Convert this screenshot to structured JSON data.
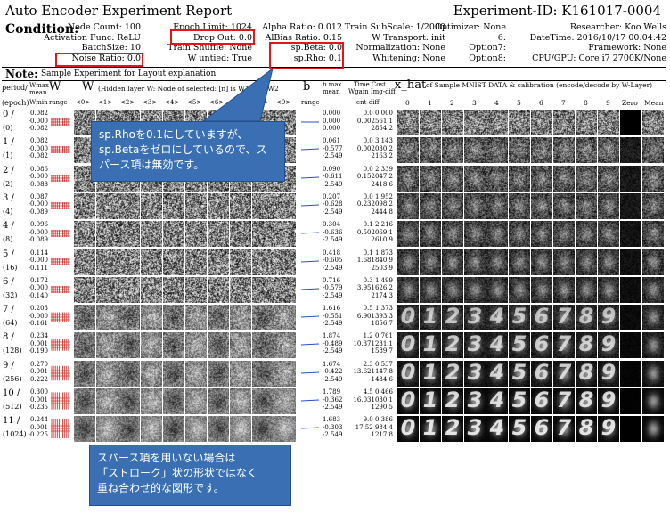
{
  "report": {
    "title": "Auto Encoder Experiment Report",
    "experiment_id": "Experiment-ID:  K161017-0004",
    "condition_label": "Condition:",
    "note_label": "Note:",
    "note_text": "Sample Experiment for Layout explanation",
    "colors": {
      "red_box": "#e8141c",
      "callout": "#3a6fb4",
      "b_line": "#2a4fd0"
    }
  },
  "conditions": {
    "col1": [
      "Node Count:  100",
      "Activation Func:  ReLU",
      "BatchSize:  10",
      "Noise Ratio:  0.0"
    ],
    "col2": [
      "Epoch Limit:  1024",
      "Drop Out:  0.0",
      "Train Shuffle:  None",
      "W untied:  True"
    ],
    "col3": [
      "Alpha Ratio:  0.012",
      "AlBias Ratio:  0.15",
      "sp.Beta:  0.0",
      "sp.Rho:  0.1"
    ],
    "col4": [
      "Train SubScale:  1/2000",
      "W Transport:  init",
      "Normalization:  None",
      "Whitening:  None"
    ],
    "col5": [
      "Optimizer:  None",
      "6:",
      "Option7:",
      "Option8:"
    ],
    "col6": [
      "Researcher:  Koo Wells",
      "DateTime:  2016/10/17  00:04:42",
      "Framework:  None",
      "CPU/GPU:  Core i7 2700K/None"
    ]
  },
  "headers": {
    "period": "period/",
    "epoch": "(epoch)",
    "wmax": "Wmax",
    "mean": "mean",
    "wmin": "Wmin",
    "w_big": "W",
    "range": "range",
    "w_title": "W",
    "w_sub": "(Hidden layer W: Node of selected: [n] is W1, n is W2",
    "w_cols": [
      "<0>",
      "<1>",
      "<2>",
      "<3>",
      "<4>",
      "<5>",
      "<6>",
      "<7>",
      "<8>",
      "<9>"
    ],
    "b_big": "b",
    "b_range": "range",
    "bmax": "b max",
    "bmean": "mean",
    "bmin": "b min",
    "time_cost": "Time Cost",
    "wgain": "Wgain  Img-diff",
    "entdiff": "ent-diff",
    "x_hat": "x_hat",
    "x_hat_sub": "of Sample MNIST DATA & calibration (encode/decode by W-Layer)",
    "x_cols": [
      "0",
      "1",
      "2",
      "3",
      "4",
      "5",
      "6",
      "7",
      "8",
      "9",
      "Zero",
      "Mean"
    ]
  },
  "rows": [
    {
      "period": "0 /",
      "epoch": "(0)",
      "w": [
        "0.082",
        "-0.000",
        "-0.082"
      ],
      "b": [
        "0.000",
        "0.000",
        "0.000"
      ],
      "c": [
        "0.0  0.000",
        "0.002561.1",
        "2854.2"
      ]
    },
    {
      "period": "1 /",
      "epoch": "(1)",
      "w": [
        "0.082",
        "-0.000",
        "-0.082"
      ],
      "b": [
        "0.061",
        "-0.577",
        "-2.549"
      ],
      "c": [
        "0.0  3.143",
        "0.002030.2",
        "2163.2"
      ]
    },
    {
      "period": "2 /",
      "epoch": "(2)",
      "w": [
        "0.086",
        "-0.000",
        "-0.088"
      ],
      "b": [
        "0.090",
        "-0.611",
        "-2.549"
      ],
      "c": [
        "0.0  2.339",
        "0.152047.2",
        "2418.6"
      ]
    },
    {
      "period": "3 /",
      "epoch": "(4)",
      "w": [
        "0.087",
        "-0.000",
        "-0.089"
      ],
      "b": [
        "0.207",
        "-0.628",
        "-2.549"
      ],
      "c": [
        "0.0  1.952",
        "0.232098.2",
        "2444.8"
      ]
    },
    {
      "period": "4 /",
      "epoch": "(8)",
      "w": [
        "0.096",
        "-0.000",
        "-0.089"
      ],
      "b": [
        "0.304",
        "-0.636",
        "-2.549"
      ],
      "c": [
        "0.1  2.216",
        "0.502069.1",
        "2610.9"
      ]
    },
    {
      "period": "5 /",
      "epoch": "(16)",
      "w": [
        "0.114",
        "-0.000",
        "-0.111"
      ],
      "b": [
        "0.418",
        "-0.605",
        "-2.549"
      ],
      "c": [
        "0.1  1.873",
        "1.681840.9",
        "2503.9"
      ]
    },
    {
      "period": "6 /",
      "epoch": "(32)",
      "w": [
        "0.172",
        "-0.000",
        "-0.140"
      ],
      "b": [
        "0.716",
        "-0.579",
        "-2.549"
      ],
      "c": [
        "0.3  1.499",
        "3.951626.2",
        "2174.3"
      ]
    },
    {
      "period": "7 /",
      "epoch": "(64)",
      "w": [
        "0.203",
        "-0.000",
        "-0.161"
      ],
      "b": [
        "1.616",
        "-0.551",
        "-2.549"
      ],
      "c": [
        "0.5  1.373",
        "6.901393.3",
        "1856.7"
      ]
    },
    {
      "period": "8 /",
      "epoch": "(128)",
      "w": [
        "0.234",
        "0.001",
        "-0.190"
      ],
      "b": [
        "1.874",
        "-0.489",
        "-2.549"
      ],
      "c": [
        "1.2  0.761",
        "10.371231.1",
        "1589.7"
      ]
    },
    {
      "period": "9 /",
      "epoch": "(256)",
      "w": [
        "0.270",
        "0.001",
        "-0.222"
      ],
      "b": [
        "1.674",
        "-0.422",
        "-2.549"
      ],
      "c": [
        "2.3  0.537",
        "13.621147.8",
        "1434.6"
      ]
    },
    {
      "period": "10 /",
      "epoch": "(512)",
      "w": [
        "0.300",
        "0.001",
        "-0.235"
      ],
      "b": [
        "1.789",
        "-0.362",
        "-2.549"
      ],
      "c": [
        "4.5  0.466",
        "16.031030.1",
        "1290.5"
      ]
    },
    {
      "period": "11 /",
      "epoch": "(1024)",
      "w": [
        "0.244",
        "0.001",
        "-0.225"
      ],
      "b": [
        "1.683",
        "-0.303",
        "-2.549"
      ],
      "c": [
        "9.0  0.386",
        "17.52  984.4",
        "1217.8"
      ]
    }
  ],
  "annotations": {
    "callout_top": [
      "sp.Rhoを0.1にしていますが、",
      "sp.Betaをゼロにしているので、ス",
      "パース項は無効です。"
    ],
    "callout_bottom": [
      "スパース項を用いない場合は",
      "「ストローク」状の形状ではなく",
      "重ね合わせ的な図形です。"
    ]
  },
  "digit_glyphs": [
    "0",
    "1",
    "2",
    "3",
    "4",
    "5",
    "6",
    "7",
    "8",
    "9"
  ]
}
